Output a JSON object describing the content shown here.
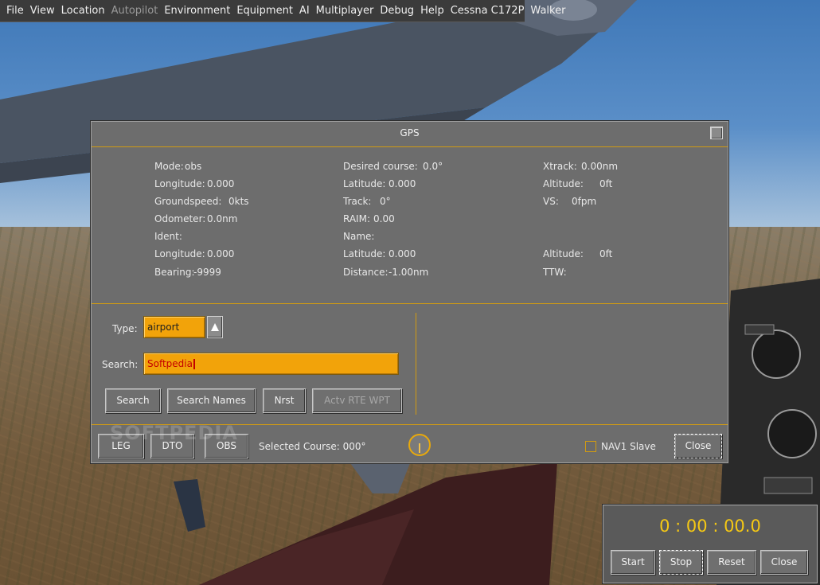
{
  "menu": {
    "items": [
      {
        "label": "File",
        "enabled": true
      },
      {
        "label": "View",
        "enabled": true
      },
      {
        "label": "Location",
        "enabled": true
      },
      {
        "label": "Autopilot",
        "enabled": false
      },
      {
        "label": "Environment",
        "enabled": true
      },
      {
        "label": "Equipment",
        "enabled": true
      },
      {
        "label": "AI",
        "enabled": true
      },
      {
        "label": "Multiplayer",
        "enabled": true
      },
      {
        "label": "Debug",
        "enabled": true
      },
      {
        "label": "Help",
        "enabled": true
      },
      {
        "label": "Cessna C172P",
        "enabled": true
      },
      {
        "label": "Walker",
        "enabled": true
      }
    ]
  },
  "gps": {
    "title": "GPS",
    "status": {
      "mode_label": "Mode:",
      "mode_value": "obs",
      "longitude_label": "Longitude:",
      "longitude_value": "0.000",
      "groundspeed_label": "Groundspeed:",
      "groundspeed_value": "0kts",
      "odometer_label": "Odometer:",
      "odometer_value": "0.0nm",
      "desired_course_label": "Desired course:",
      "desired_course_value": "0.0°",
      "latitude_label": "Latitude:",
      "latitude_value": "0.000",
      "track_label": "Track:",
      "track_value": "0°",
      "raim_label": "RAIM:",
      "raim_value": "0.00",
      "xtrack_label": "Xtrack:",
      "xtrack_value": "0.00nm",
      "altitude_label": "Altitude:",
      "altitude_value": "0ft",
      "vs_label": "VS:",
      "vs_value": "0fpm"
    },
    "waypoint": {
      "ident_label": "Ident:",
      "name_label": "Name:",
      "longitude_label": "Longitude:",
      "longitude_value": "0.000",
      "latitude_label": "Latitude:",
      "latitude_value": "0.000",
      "altitude_label": "Altitude:",
      "altitude_value": "0ft",
      "bearing_label": "Bearing:",
      "bearing_value": "-9999",
      "distance_label": "Distance:",
      "distance_value": "-1.00nm",
      "ttw_label": "TTW:"
    },
    "search_panel": {
      "type_label": "Type:",
      "type_value": "airport",
      "search_label": "Search:",
      "search_value": "Softpedia",
      "search_button": "Search",
      "search_names_button": "Search Names",
      "nrst_button": "Nrst",
      "actv_button": "Actv RTE WPT"
    },
    "bottom": {
      "leg_button": "LEG",
      "dto_button": "DTO",
      "obs_button": "OBS",
      "selected_course_label": "Selected Course: 000°",
      "nav1_slave_label": "NAV1 Slave",
      "close_button": "Close"
    }
  },
  "watermark": "SOFTPEDIA",
  "stopwatch": {
    "time": "0 : 00 : 00.0",
    "start_button": "Start",
    "stop_button": "Stop",
    "reset_button": "Reset",
    "close_button": "Close"
  },
  "colors": {
    "accent": "#d19b12",
    "field": "#f2a30a",
    "dialog_bg": "#6d6d6d",
    "timer_text": "#f5c814"
  }
}
